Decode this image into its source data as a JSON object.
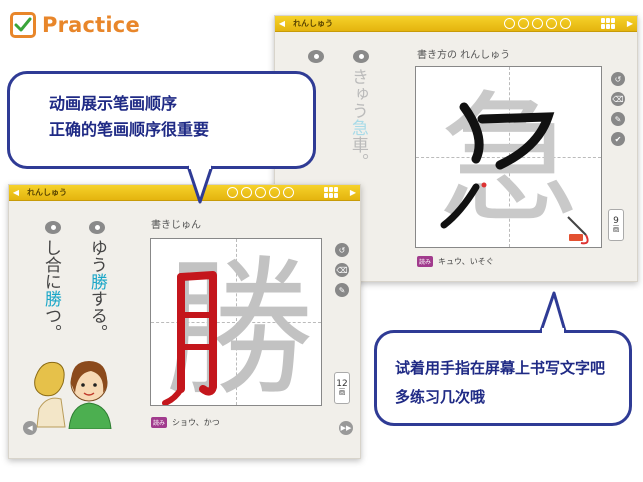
{
  "header": {
    "title": "Practice"
  },
  "colors": {
    "accent_orange": "#e8862a",
    "bar_yellow": "#f1c61b",
    "bubble_blue": "#2f3b95",
    "highlight_cyan": "#1ca7c8",
    "char_red": "#c4161c",
    "reading_tag": "#a13b8d"
  },
  "back_card": {
    "bar_title": "れんしゅう",
    "mode_label": "書き方の れんしゅう",
    "sentence": {
      "before": "きゅう",
      "highlight": "急",
      "after": "車。",
      "furigana": "きゅう"
    },
    "character": "急",
    "reading_tag": "読み",
    "readings": "キュウ、いそぐ",
    "stroke_count": "9",
    "stroke_unit": "画"
  },
  "front_card": {
    "bar_title": "れんしゅう",
    "mode_label": "書きじゅん",
    "sentence_col1": {
      "before": "ゆう",
      "highlight": "勝",
      "after": "する。",
      "furigana": "しょう"
    },
    "sentence_col2": {
      "before": "し合に",
      "highlight": "勝",
      "after": "つ。",
      "furigana": "か"
    },
    "character": "勝",
    "reading_tag": "読み",
    "readings": "ショウ、かつ",
    "stroke_count": "12",
    "stroke_unit": "画"
  },
  "bubble_top": {
    "line1": "动画展示笔画顺序",
    "line2": "正确的笔画顺序很重要"
  },
  "bubble_bottom": {
    "line1": "试着用手指在屏幕上书写文字吧",
    "line2": "多练习几次哦"
  },
  "icons": {
    "check": "checkmark-icon",
    "speaker": "speaker-icon",
    "grid": "grid-menu-icon",
    "eraser": "eraser-icon",
    "pencil": "pencil-icon",
    "stamp": "stamp-icon"
  }
}
